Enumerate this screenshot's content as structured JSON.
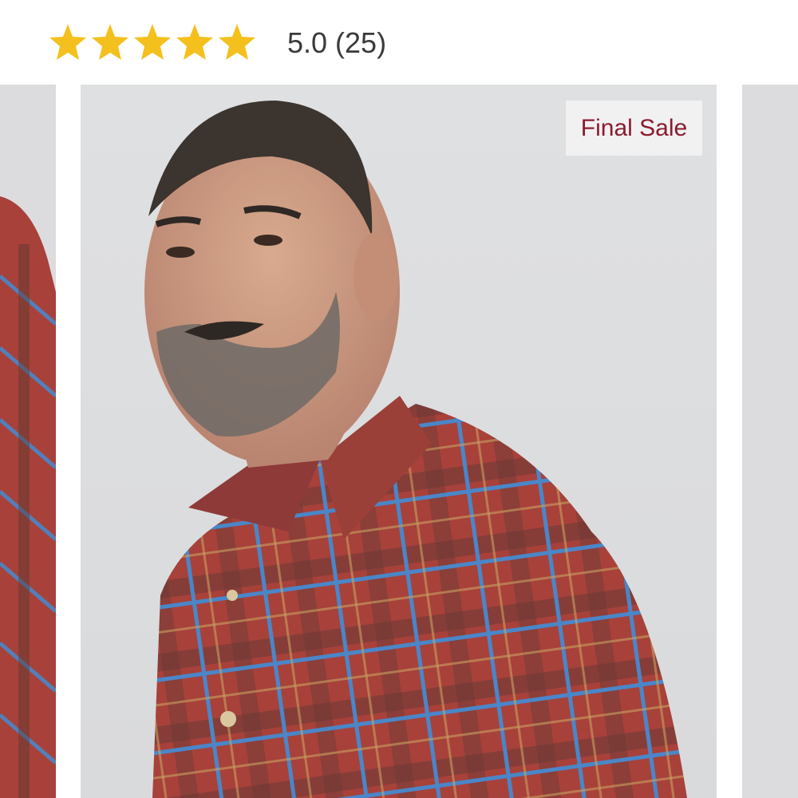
{
  "product": {
    "rating": {
      "value": 5.0,
      "max": 5,
      "text": "5.0 (25)"
    },
    "badge": {
      "label": "Final Sale"
    }
  },
  "colors": {
    "star": "#f4c01e",
    "badge_text": "#8a1c2e",
    "badge_bg": "#f1f1f2",
    "rating_text": "#3a3a3a",
    "photo_bg": "#dcdcde",
    "shirt_red": "#a8413a",
    "shirt_blue": "#4a86c8"
  },
  "icons": {
    "star": "star-icon"
  }
}
